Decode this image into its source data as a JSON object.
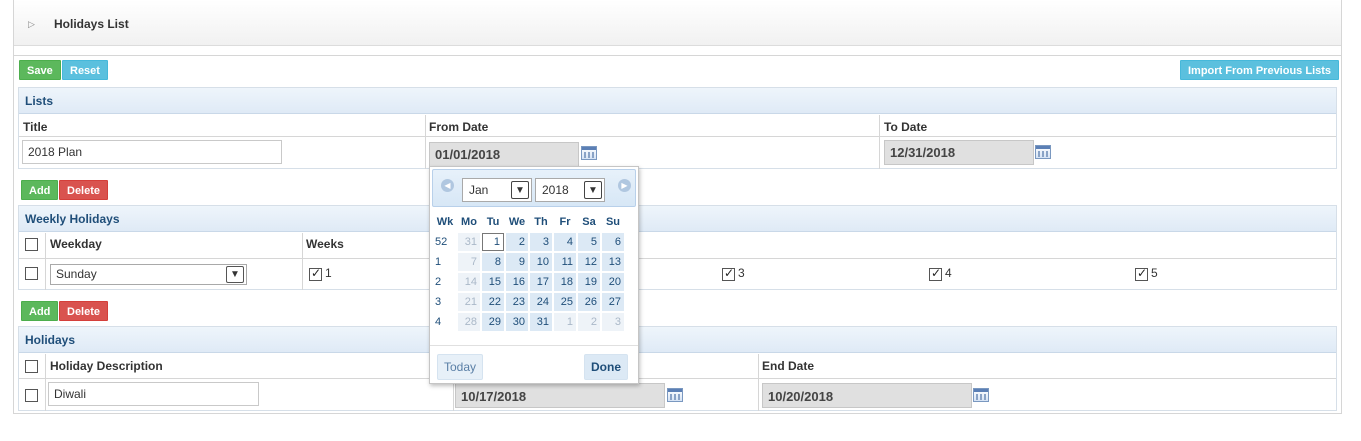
{
  "page": {
    "title": "Holidays List"
  },
  "toolbar": {
    "save": "Save",
    "reset": "Reset",
    "import": "Import From Previous Lists"
  },
  "lists": {
    "header": "Lists",
    "col_title": "Title",
    "col_from": "From Date",
    "col_to": "To Date",
    "title_value": "2018 Plan",
    "from_value": "01/01/2018",
    "to_value": "12/31/2018"
  },
  "weekly": {
    "add": "Add",
    "delete": "Delete",
    "header": "Weekly Holidays",
    "col_weekday": "Weekday",
    "col_weeks": "Weeks",
    "weekday_value": "Sunday",
    "weeks": [
      {
        "label": "1",
        "checked": true
      },
      {
        "label": "3",
        "checked": true
      },
      {
        "label": "4",
        "checked": true
      },
      {
        "label": "5",
        "checked": true
      }
    ]
  },
  "holidays": {
    "add": "Add",
    "delete": "Delete",
    "header": "Holidays",
    "col_desc": "Holiday Description",
    "col_end": "End Date",
    "desc_value": "Diwali",
    "start_value": "10/17/2018",
    "end_value": "10/20/2018"
  },
  "datepicker": {
    "month": "Jan",
    "year": "2018",
    "head": [
      "Wk",
      "Mo",
      "Tu",
      "We",
      "Th",
      "Fr",
      "Sa",
      "Su"
    ],
    "rows": [
      [
        "52",
        "31",
        "1",
        "2",
        "3",
        "4",
        "5",
        "6"
      ],
      [
        "1",
        "7",
        "8",
        "9",
        "10",
        "11",
        "12",
        "13"
      ],
      [
        "2",
        "14",
        "15",
        "16",
        "17",
        "18",
        "19",
        "20"
      ],
      [
        "3",
        "21",
        "22",
        "23",
        "24",
        "25",
        "26",
        "27"
      ],
      [
        "4",
        "28",
        "29",
        "30",
        "31",
        "1",
        "2",
        "3"
      ]
    ],
    "today": "Today",
    "done": "Done"
  },
  "colors": {
    "green": "#5cb85c",
    "blue": "#5bc0de",
    "red": "#d9534f",
    "header_text": "#1f4e79"
  },
  "icons": [
    "expand-arrow-icon",
    "calendar-icon",
    "prev-month-icon",
    "next-month-icon",
    "dropdown-arrow-icon",
    "checkbox-icon"
  ]
}
